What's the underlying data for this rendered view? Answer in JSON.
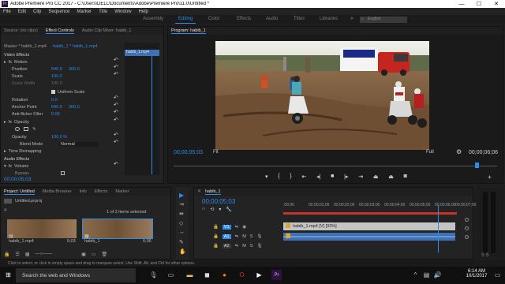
{
  "titlebar": {
    "title": "Adobe Premiere Pro CC 2017 - C:\\Users\\DELL\\Documents\\Adobe\\Premiere Pro\\11.0\\Untitled *",
    "app_icon": "Pr",
    "minimize": "—",
    "maximize": "☐",
    "close": "✕"
  },
  "menu": [
    "File",
    "Edit",
    "Clip",
    "Sequence",
    "Marker",
    "Title",
    "Window",
    "Help"
  ],
  "workspaces": {
    "tabs": [
      "Assembly",
      "Editing",
      "Color",
      "Effects",
      "Audio",
      "Titles",
      "Libraries"
    ],
    "active": "Editing",
    "search_placeholder": "English"
  },
  "source_panel": {
    "tabs": [
      "Source: (no clips)",
      "Effect Controls",
      "Audio Clip Mixer: habib_1"
    ],
    "master_label": "Master * habib_1.mp4",
    "clip_label": "habib_1 * habib_1.mp4",
    "mini_clip": "habib_1.mp4",
    "video_effects": "Video Effects",
    "motion": "Motion",
    "position_label": "Position",
    "position_x": "640.0",
    "position_y": "360.0",
    "scale_label": "Scale",
    "scale_value": "100.0",
    "scale_width_label": "Scale Width",
    "scale_width_value": "100.0",
    "uniform_scale": "Uniform Scale",
    "rotation_label": "Rotation",
    "rotation_value": "0.0",
    "anchor_label": "Anchor Point",
    "anchor_x": "640.0",
    "anchor_y": "360.0",
    "antiflicker_label": "Anti-flicker Filter",
    "antiflicker_value": "0.00",
    "opacity": "Opacity",
    "opacity_label": "Opacity",
    "opacity_value": "100.0 %",
    "blend_label": "Blend Mode",
    "blend_value": "Normal",
    "time_remap": "Time Remapping",
    "audio_effects": "Audio Effects",
    "volume": "Volume",
    "bypass": "Bypass",
    "timecode": "00;00;05;03"
  },
  "program": {
    "tab": "Program: habib_1",
    "timecode": "00;00;05;03",
    "fit": "Fit",
    "quality": "Full",
    "duration": "00;00;06;06"
  },
  "project": {
    "tabs": [
      "Project: Untitled",
      "Media Browser",
      "Info",
      "Effects",
      "Marker"
    ],
    "file": "Untitled.prproj",
    "selection": "1 of 2 items selected",
    "items": [
      {
        "name": "habib_1.mp4",
        "dur": "5;03"
      },
      {
        "name": "habib_1",
        "dur": "6;06"
      }
    ]
  },
  "timeline": {
    "tab": "habib_1",
    "timecode": "00;00;05;03",
    "ruler": [
      ";00;00",
      "00;00;01;00",
      "00;00;02;00",
      "00;00;03;00",
      "00;00;04;00",
      "00;00;05;00",
      "00;00;06;00",
      "00;00;07;00"
    ],
    "tracks": {
      "v1": "V1",
      "a1": "A1",
      "a2": "A2",
      "m": "M",
      "s": "S"
    },
    "video_clip": "habib_1.mp4 [V] [33%]",
    "playhead_fraction": 0.9
  },
  "status_bar": "Click to select, or click in empty space and drag to marquee select. Use Shift, Alt, and Ctrl for other options.",
  "taskbar": {
    "search": "Search the web and Windows",
    "time": "6:14 AM",
    "date": "10/1/2017"
  },
  "colors": {
    "accent": "#2d8ceb",
    "panel": "#232323",
    "background": "#1e1e1e",
    "video_clip": "#c4c4c4",
    "audio_clip": "#3e70b4",
    "premiere_icon": "#2b1540"
  }
}
